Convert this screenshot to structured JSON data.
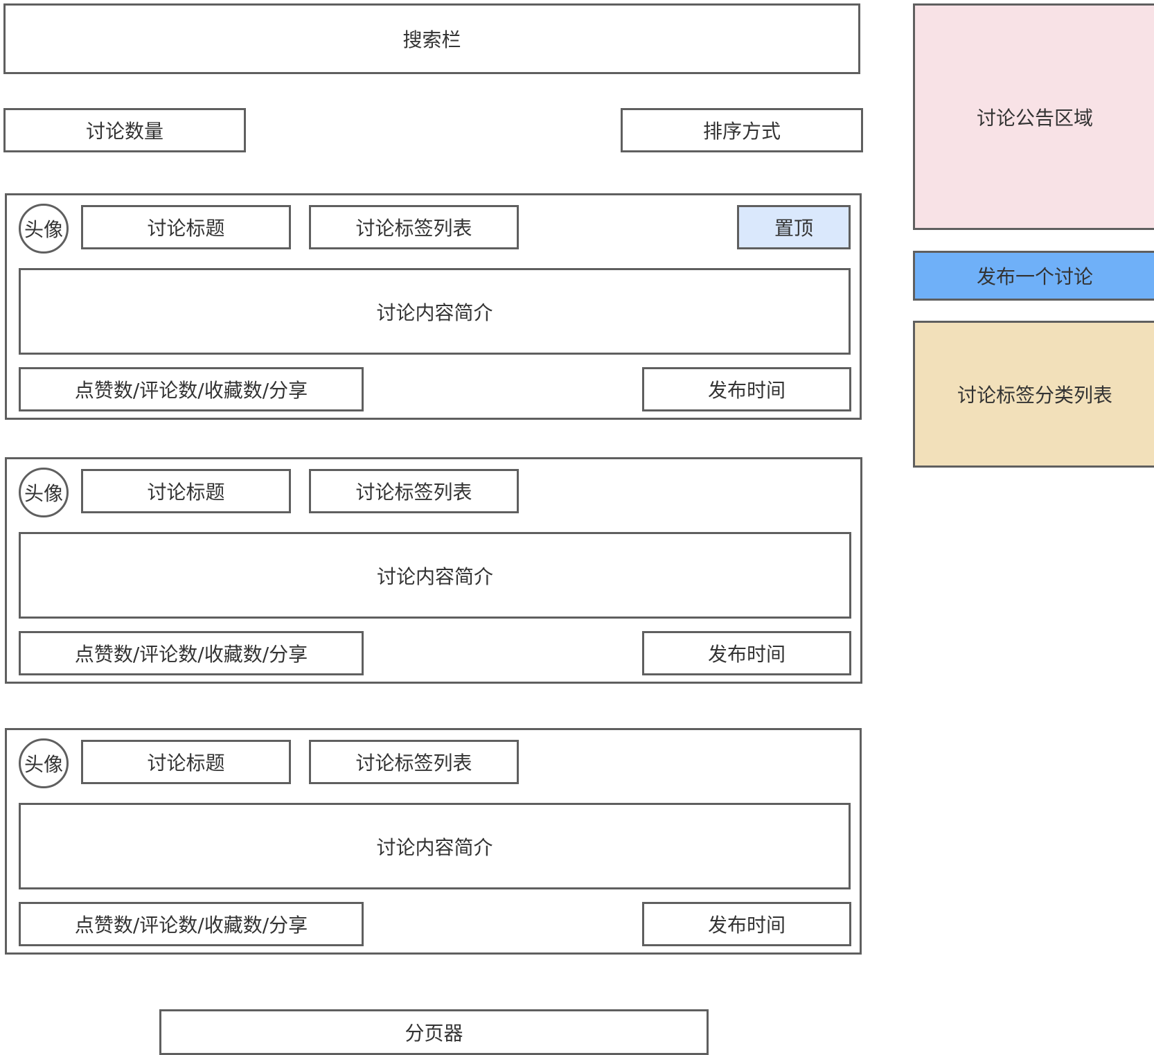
{
  "search_bar": "搜索栏",
  "discussion_count": "讨论数量",
  "sort_mode": "排序方式",
  "pagination": "分页器",
  "sidebar": {
    "notice_area": "讨论公告区域",
    "publish_button": "发布一个讨论",
    "tag_categories": "讨论标签分类列表"
  },
  "posts": [
    {
      "avatar": "头像",
      "title": "讨论标题",
      "tags": "讨论标签列表",
      "pinned": "置顶",
      "summary": "讨论内容简介",
      "stats": "点赞数/评论数/收藏数/分享",
      "time": "发布时间"
    },
    {
      "avatar": "头像",
      "title": "讨论标题",
      "tags": "讨论标签列表",
      "summary": "讨论内容简介",
      "stats": "点赞数/评论数/收藏数/分享",
      "time": "发布时间"
    },
    {
      "avatar": "头像",
      "title": "讨论标题",
      "tags": "讨论标签列表",
      "summary": "讨论内容简介",
      "stats": "点赞数/评论数/收藏数/分享",
      "time": "发布时间"
    }
  ],
  "colors": {
    "border": "#5f5f5f",
    "pin_bg": "#dae8fc",
    "notice_bg": "#f8e2e6",
    "publish_bg": "#6fb0f8",
    "tags_bg": "#f2e0ba"
  }
}
